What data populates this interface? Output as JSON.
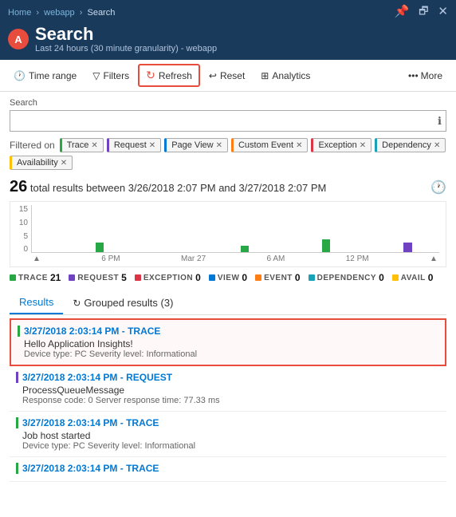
{
  "breadcrumb": {
    "items": [
      "Home",
      "webapp",
      "Search"
    ]
  },
  "titlebar": {
    "title": "Search",
    "subtitle": "Last 24 hours (30 minute granularity) - webapp",
    "icon_label": "A",
    "controls": [
      "pin",
      "restore",
      "close"
    ]
  },
  "toolbar": {
    "time_range": "Time range",
    "filters": "Filters",
    "refresh": "Refresh",
    "reset": "Reset",
    "analytics": "Analytics",
    "more": "More"
  },
  "search": {
    "label": "Search",
    "placeholder": "",
    "info_icon": "ℹ"
  },
  "filters": {
    "label": "Filtered on",
    "tags": [
      {
        "name": "Trace",
        "type": "trace"
      },
      {
        "name": "Request",
        "type": "request"
      },
      {
        "name": "Page View",
        "type": "pageview"
      },
      {
        "name": "Custom Event",
        "type": "customevent"
      },
      {
        "name": "Exception",
        "type": "exception"
      },
      {
        "name": "Dependency",
        "type": "dependency"
      },
      {
        "name": "Availability",
        "type": "availability"
      }
    ]
  },
  "results_summary": {
    "count": "26",
    "text": "total results between 3/26/2018 2:07 PM and 3/27/2018 2:07 PM"
  },
  "chart": {
    "y_labels": [
      "15",
      "10",
      "5",
      "0"
    ],
    "x_labels": [
      "6 PM",
      "Mar 27",
      "6 AM",
      "12 PM"
    ],
    "bars": [
      0,
      0,
      0,
      0,
      0,
      0,
      0,
      3,
      0,
      0,
      0,
      0,
      0,
      0,
      0,
      0,
      0,
      0,
      0,
      0,
      0,
      0,
      0,
      2,
      0,
      0,
      0,
      0,
      0,
      0,
      0,
      0,
      4,
      0,
      0,
      0,
      0,
      0,
      0,
      0,
      0,
      3,
      0,
      0,
      0
    ]
  },
  "legend": [
    {
      "label": "TRACE",
      "count": "21",
      "color": "#28a745"
    },
    {
      "label": "REQUEST",
      "count": "5",
      "color": "#6f42c1"
    },
    {
      "label": "EXCEPTION",
      "count": "0",
      "color": "#dc3545"
    },
    {
      "label": "VIEW",
      "count": "0",
      "color": "#0078d4"
    },
    {
      "label": "EVENT",
      "count": "0",
      "color": "#fd7e14"
    },
    {
      "label": "DEPENDENCY",
      "count": "0",
      "color": "#17a2b8"
    },
    {
      "label": "AVAIL",
      "count": "0",
      "color": "#ffc107"
    }
  ],
  "tabs": {
    "results_label": "Results",
    "grouped_label": "Grouped results (3)"
  },
  "result_items": [
    {
      "timestamp": "3/27/2018 2:03:14 PM - TRACE",
      "type": "trace",
      "title_line": "Hello Application Insights!",
      "meta_line": "Device type: PC Severity level: Informational",
      "selected": true
    },
    {
      "timestamp": "3/27/2018 2:03:14 PM - REQUEST",
      "type": "request",
      "title_line": "ProcessQueueMessage",
      "meta_line": "Response code: 0  Server response time: 77.33 ms",
      "selected": false
    },
    {
      "timestamp": "3/27/2018 2:03:14 PM - TRACE",
      "type": "trace",
      "title_line": "Job host started",
      "meta_line": "Device type: PC Severity level: Informational",
      "selected": false
    },
    {
      "timestamp": "3/27/2018 2:03:14 PM - TRACE",
      "type": "trace",
      "title_line": "",
      "meta_line": "",
      "selected": false
    }
  ]
}
